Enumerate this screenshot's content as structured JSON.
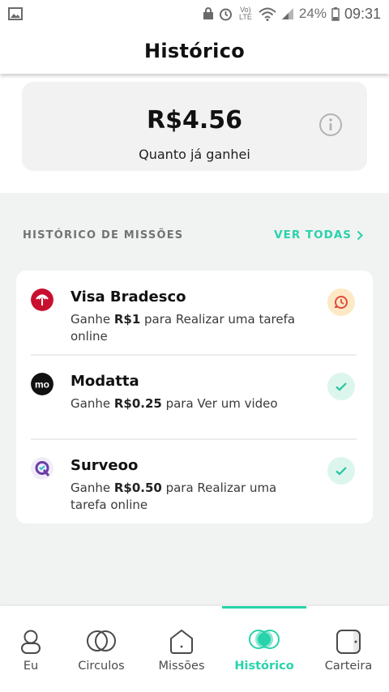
{
  "status_bar": {
    "volte_label": "Vo) LTE",
    "battery": "24%",
    "time": "09:31"
  },
  "header": {
    "title": "Histórico"
  },
  "earnings": {
    "amount": "R$4.56",
    "label": "Quanto já ganhei",
    "info_icon": "info-icon"
  },
  "missions_section": {
    "title": "HISTÓRICO DE MISSÕES",
    "see_all": "VER TODAS",
    "items": [
      {
        "name": "Visa Bradesco",
        "desc_prefix": "Ganhe ",
        "reward": "R$1",
        "desc_suffix": " para Realizar uma tarefa online",
        "status": "pending",
        "status_icon": "clock-alert-icon",
        "brand_color": "#c8102e"
      },
      {
        "name": "Modatta",
        "desc_prefix": "Ganhe ",
        "reward": "R$0.25",
        "desc_suffix": " para Ver um video",
        "status": "done",
        "status_icon": "check-icon",
        "brand_color": "#111111"
      },
      {
        "name": "Surveoo",
        "desc_prefix": "Ganhe ",
        "reward": "R$0.50",
        "desc_suffix": " para Realizar uma tarefa online",
        "status": "done",
        "status_icon": "check-icon",
        "brand_color": "#6a3da8"
      }
    ]
  },
  "tabs": [
    {
      "label": "Eu",
      "icon": "user-icon",
      "active": false
    },
    {
      "label": "Circulos",
      "icon": "circles-icon",
      "active": false
    },
    {
      "label": "Missões",
      "icon": "house-icon",
      "active": false
    },
    {
      "label": "Histórico",
      "icon": "history-icon",
      "active": true
    },
    {
      "label": "Carteira",
      "icon": "wallet-icon",
      "active": false
    }
  ],
  "colors": {
    "accent": "#28d3ab",
    "pending_bg": "#fde9c5",
    "pending_fg": "#e34b3b",
    "done_bg": "#dcf6ee",
    "done_fg": "#28c49d"
  }
}
